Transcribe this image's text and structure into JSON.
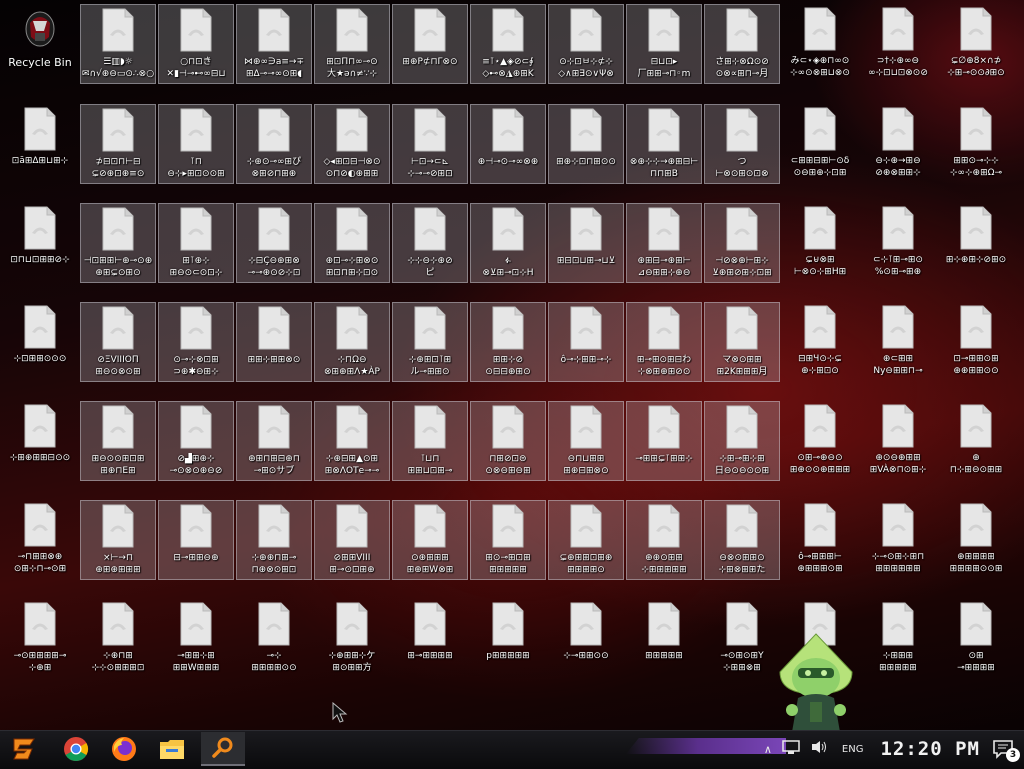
{
  "recycle_bin": {
    "label": "Recycle Bin"
  },
  "desktop_icons": [
    [
      {
        "label": "☰▥◗☼\n✉∩√⊕⊖▭⊙∴⊗○",
        "selected": true
      },
      {
        "label": "○⊓⊡き\n✕▮⊣⊸⊷∞⊟⊔",
        "selected": true
      },
      {
        "label": "⋈⊕∞∋a≡→∓\n⊞Δ⊸⊸∞⊙⊞◖",
        "selected": true
      },
      {
        "label": "⊞⊡Π⊓∞⊸⊙\n大★ə∩≠∵⊹",
        "selected": true
      },
      {
        "label": "⊞⊕Ρ⊄⊓Γ⊗⊙",
        "selected": true
      },
      {
        "label": "≡⊺⋆▲◈⊘⊂∮\n◇⊷⊗◮⊕⊞K",
        "selected": true
      },
      {
        "label": "⊙⊹⊡ㅂ⊹⊄⊹\n◇∧⊞∃⊙∨Ψ⊗",
        "selected": true
      },
      {
        "label": "⊟⊔⊡▸\n厂⊞⊞⊸⊓◦m",
        "selected": true
      },
      {
        "label": "さ⊞⊹⊗Ω⊙⊘\n⊙⊗∝⊞⊓⊸月",
        "selected": true
      },
      {
        "label": "み⊂⋆◈⊕⊓∞⊙\n⊹∞⊙⊗⊞⊔⊗⊙",
        "selected": false
      },
      {
        "label": "⊃†⊹⊕∞⊖\n∞⊹⊡⊔⊡⊗⊙⊘",
        "selected": false
      },
      {
        "label": "⊊∅⊕8×∩⊅\n⊹⊞⊸⊙⊙∂⊞⊙",
        "selected": false
      }
    ],
    [
      {
        "label": "⊡ā⊞Δ⊞⊔⊞⊹",
        "selected": false
      },
      {
        "label": "⊅⊟⊡⊓⊢⊟\n⊊⊘⊕⊡⊕≡⊙",
        "selected": true
      },
      {
        "label": "⊺⊓\n⊖⊹▸⊞⊡⊙⊙⊞",
        "selected": true
      },
      {
        "label": "⊹⊕⊙⊸∞⊞ぴ\n⊗⊞⊘⊓⊞⊕",
        "selected": true
      },
      {
        "label": "◇◂⊞⊡⊟⊣⊗⊙\n⊙⊓⊘◐⊕⊞⊞",
        "selected": true
      },
      {
        "label": "⊢⊡→⊂⊾\n⊹⊸⊸⊘⊞⊡",
        "selected": true
      },
      {
        "label": "⊕⊣⊸⊙⊸∞⊗⊕",
        "selected": true
      },
      {
        "label": "⊞⊕⊹⊡⊓⊞⊙⊙",
        "selected": true
      },
      {
        "label": "⊗⊕⊹⊹→⊕⊞⊟⊢\n⊓⊓⊞B",
        "selected": true
      },
      {
        "label": "つ\n⊢⊗⊙⊞⊙⊡⊗",
        "selected": true
      },
      {
        "label": "⊂⊞⊞⊟⊞⊢⊙δ\n⊙⊖⊞⊕⊹⊡⊞",
        "selected": false
      },
      {
        "label": "⊖⊹⊕→⊞⊖\n⊘⊕⊗⊞⊞⊹",
        "selected": false
      },
      {
        "label": "⊞⊞⊙⊸⊹⊹\n⊹∞⊹⊕⊞Ω⊸",
        "selected": false
      }
    ],
    [
      {
        "label": "⊡⊓⊔⊡⊞⊞⊘⊹",
        "selected": false
      },
      {
        "label": "⊣⊡⊞⊞⊢⊕⊸⊙⊕\n⊕⊞⊊⊙⊞⊙",
        "selected": true
      },
      {
        "label": "⊞⊺⊕⊹\n⊞⊖⊙⊂⊙⊡⊹",
        "selected": true
      },
      {
        "label": "⊹⊟Ç⊖⊕⊞⊗\n⊸⊸⊕⊙⊘⊹⊡",
        "selected": true
      },
      {
        "label": "⊕⊡⊸⊹⊞⊗⊙\n⊞⊡⊓⊞⊹⊡⊙",
        "selected": true
      },
      {
        "label": "⊹⊹⊖⊹⊕⊘\nピ",
        "selected": true
      },
      {
        "label": "ፉ\n⊗⊻⊞⊸⊡⊹H",
        "selected": true
      },
      {
        "label": "⊞⊟⊡⊔⊞⊸⊔⊻",
        "selected": true
      },
      {
        "label": "⊕⊞⊟⊸⊕⊞⊢\n⊿⊖⊞⊞⊹⊕⊖",
        "selected": true
      },
      {
        "label": "⊣⊘⊗⊕⊢⊞⊹\n⊻⊕⊞⊘⊞⊹⊡⊞",
        "selected": true
      },
      {
        "label": "⊊⊌⊗⊞\n⊢⊗⊙⊹⊞H⊞",
        "selected": false
      },
      {
        "label": "⊂⊹⊺⊞⊸⊞⊙\n%⊙⊞⊸⊞⊕",
        "selected": false
      },
      {
        "label": "⊞⊹⊕⊞⊹⊘⊞⊙",
        "selected": false
      }
    ],
    [
      {
        "label": "⊹⊡⊞⊞⊙⊙⊙",
        "selected": false
      },
      {
        "label": "⊘ΞVIIIOΠ\n⊞⊖⊙⊗⊙⊞",
        "selected": true
      },
      {
        "label": "⊙⊸⊹⊗⊡⊞\n⊃⊕✱⊖⊞⊹",
        "selected": true
      },
      {
        "label": "⊞⊞⊹⊞⊞⊗⊙",
        "selected": true
      },
      {
        "label": "⊹⊓Ω⊖\n⊗⊞⊕⊞Λ★ÀΡ",
        "selected": true
      },
      {
        "label": "⊹⊕⊞⊡⊺⊞\nル⊸⊞⊞⊙",
        "selected": true
      },
      {
        "label": "⊞⊞⊹⊘\n⊙⊟⊟⊕⊞⊙",
        "selected": true
      },
      {
        "label": "ô⊸⊹⊞⊞⊸⊹",
        "selected": true
      },
      {
        "label": "⊞⊸⊞⊙⊞⊟わ\n⊹⊗⊞⊕⊞⊘⊙",
        "selected": true
      },
      {
        "label": "マ⊗⊙⊞⊞\n⊞2K⊞⊞⊞月",
        "selected": true
      },
      {
        "label": "⊟⊞Ч⊙⊹⊊\n⊕⊹⊞⊡⊙",
        "selected": false
      },
      {
        "label": "⊕⊂⊞⊞\nNy⊖⊞⊞⊓⊸",
        "selected": false
      },
      {
        "label": "⊡⊸⊞⊞⊙⊞\n⊕⊕⊞⊞⊙⊙",
        "selected": false
      }
    ],
    [
      {
        "label": "⊹⊞⊕⊞⊞⊟⊙⊙",
        "selected": false
      },
      {
        "label": "⊞⊖⊙⊙⊞⊡⊞\n⊞⊕⊓Ε⊞",
        "selected": true
      },
      {
        "label": "⊘▟⊞⊕⊹\n⊸⊙⊗⊙⊕⊖⊘",
        "selected": true
      },
      {
        "label": "⊕⊞⊓⊞⊟⊕⊓\n⊸⊞⊙サブ",
        "selected": true
      },
      {
        "label": "⊹⊕⊟⊞▲⊙⊞\n⊞⊗ΛΟΤe⊸⊸",
        "selected": true
      },
      {
        "label": "⊺⊔⊓\n⊞⊞⊔⊡⊞⊸",
        "selected": true
      },
      {
        "label": "⊓⊞⊘⊡⊜\n⊙⊗⊖⊞⊖⊞",
        "selected": true
      },
      {
        "label": "⊖⊓⊔⊞⊞\n⊞⊕⊟⊞⊗⊙",
        "selected": true
      },
      {
        "label": "⊸⊞⊞⊊⊺⊞⊞⊹",
        "selected": true
      },
      {
        "label": "⊹⊞⊸⊞⊹⊞\n日⊖⊙⊖⊙⊙⊞",
        "selected": true
      },
      {
        "label": "⊙⊞⊸⊕⊖⊙\n⊞⊕⊙⊙⊕⊞⊞⊞",
        "selected": false
      },
      {
        "label": "⊕⊙⊖⊕⊞⊞\n⊞VÀ⊗⊓⊙⊞⊹",
        "selected": false
      },
      {
        "label": "⊕\n⊓⊹⊞⊖⊙⊞⊞",
        "selected": false
      }
    ],
    [
      {
        "label": "⊸⊓⊞⊞⊗⊕\n⊙⊞⊹⊓⊸⊙⊞",
        "selected": false
      },
      {
        "label": "×⊢→⊓\n⊕⊞⊕⊞⊞⊞",
        "selected": true
      },
      {
        "label": "⊟⊸⊞⊞⊖⊕",
        "selected": true
      },
      {
        "label": "⊹⊕⊕⊓⊞⊸\n⊓⊕⊗⊙⊞⊡",
        "selected": true
      },
      {
        "label": "⊘⊞⊞VIII\n⊞⊸⊙⊡⊞⊕",
        "selected": true
      },
      {
        "label": "⊙⊕⊞⊞⊞\n⊞⊕⊞W⊗⊞",
        "selected": true
      },
      {
        "label": "⊞⊙⊸⊞⊡⊞\n⊞⊞⊞⊞⊞",
        "selected": true
      },
      {
        "label": "⊊⊕⊞⊞⊡⊞⊕\n⊞⊞⊞⊞⊙",
        "selected": true
      },
      {
        "label": "⊕⊕⊙⊞⊞\n⊹⊞⊞⊞⊞⊞",
        "selected": true
      },
      {
        "label": "⊖⊗⊙⊞⊞⊙\n⊹⊞⊗⊞⊞た",
        "selected": true
      },
      {
        "label": "ô⊸⊞⊞⊞⊢\n⊕⊞⊞⊞⊙⊞",
        "selected": false
      },
      {
        "label": "⊹⊸⊙⊞⊹⊞⊓\n⊞⊞⊞⊞⊞⊞",
        "selected": false
      },
      {
        "label": "⊕⊞⊞⊞⊞\n⊞⊞⊞⊞⊙⊙⊞",
        "selected": false
      }
    ],
    [
      {
        "label": "⊸⊙⊞⊞⊞⊞⊸\n⊹⊕⊞",
        "selected": false
      },
      {
        "label": "⊹⊕⊓⊞\n⊹⊹⊙⊞⊞⊞⊡",
        "selected": false
      },
      {
        "label": "⊸⊞⊞⊹⊞\n⊞⊞W⊞⊞⊞",
        "selected": false
      },
      {
        "label": "⊸⊹\n⊞⊞⊞⊞⊙⊙",
        "selected": false
      },
      {
        "label": "⊹⊕⊞⊞⊹ケ\n⊞⊙⊞⊞方",
        "selected": false
      },
      {
        "label": "⊞⊸⊞⊞⊞⊞",
        "selected": false
      },
      {
        "label": "p⊞⊞⊞⊞⊞",
        "selected": false
      },
      {
        "label": "⊹⊸⊞⊞⊙⊙",
        "selected": false
      },
      {
        "label": "⊞⊞⊞⊞⊞",
        "selected": false
      },
      {
        "label": "⊸⊙⊞⊙⊞Y\n⊹⊞⊞⊗⊞",
        "selected": false
      },
      {
        "label": "",
        "selected": false
      },
      {
        "label": "⊹⊞⊞⊞\n⊞⊞⊞⊞⊞",
        "selected": false
      },
      {
        "label": "⊙⊞\n⊸⊞⊞⊞⊞",
        "selected": false
      }
    ]
  ],
  "taskbar": {
    "start_icon": "start-logo-icon",
    "pinned": [
      {
        "name": "chrome-icon"
      },
      {
        "name": "firefox-icon"
      },
      {
        "name": "file-explorer-icon"
      }
    ],
    "search_icon": "search-icon",
    "tray": {
      "network_icon": "network-icon",
      "volume_icon": "volume-icon",
      "language": "ENG",
      "time": "12:20 PM",
      "notification_count": "3"
    }
  },
  "colors": {
    "accent_purple": "#6a3aa2",
    "search_bg": "#2c2d31",
    "start_orange": "#f08a1c"
  }
}
